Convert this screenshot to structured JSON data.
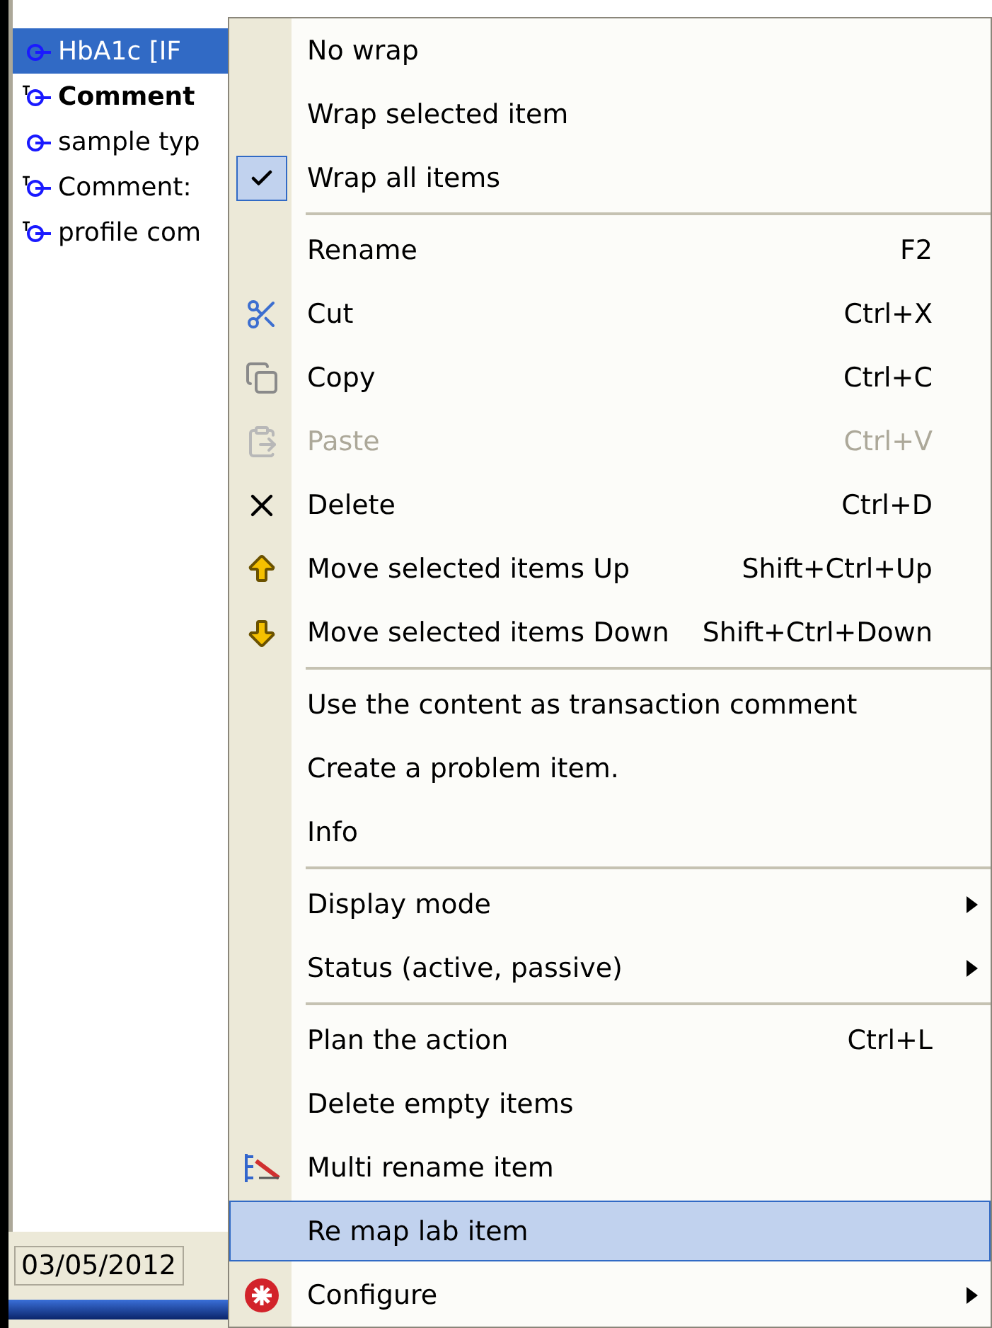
{
  "tree": {
    "rows": [
      {
        "label": "HbA1c [IF",
        "kind": "plain",
        "bold": false,
        "selected": true
      },
      {
        "label": "Comment",
        "kind": "text",
        "bold": true,
        "selected": false
      },
      {
        "label": "sample typ",
        "kind": "plain",
        "bold": false,
        "selected": false
      },
      {
        "label": "Comment:",
        "kind": "text",
        "bold": false,
        "selected": false
      },
      {
        "label": "profile com",
        "kind": "text",
        "bold": false,
        "selected": false
      }
    ]
  },
  "status_bar": {
    "date": "03/05/2012"
  },
  "context_menu": {
    "items": [
      {
        "kind": "plain",
        "label": "No wrap",
        "checked": false,
        "selected": false
      },
      {
        "kind": "plain",
        "label": "Wrap selected item",
        "checked": false,
        "selected": false
      },
      {
        "kind": "plain",
        "label": "Wrap all items",
        "checked": true,
        "selected": false
      },
      {
        "kind": "separator"
      },
      {
        "kind": "plain",
        "label": "Rename",
        "shortcut": "F2",
        "selected": false
      },
      {
        "kind": "cut",
        "label": "Cut",
        "shortcut": "Ctrl+X",
        "selected": false
      },
      {
        "kind": "copy",
        "label": "Copy",
        "shortcut": "Ctrl+C",
        "selected": false
      },
      {
        "kind": "paste",
        "label": "Paste",
        "shortcut": "Ctrl+V",
        "disabled": true,
        "selected": false
      },
      {
        "kind": "delete",
        "label": "Delete",
        "shortcut": "Ctrl+D",
        "selected": false
      },
      {
        "kind": "up",
        "label": "Move selected items Up",
        "shortcut": "Shift+Ctrl+Up",
        "selected": false
      },
      {
        "kind": "down",
        "label": "Move selected items Down",
        "shortcut": "Shift+Ctrl+Down",
        "selected": false
      },
      {
        "kind": "separator"
      },
      {
        "kind": "plain",
        "label": "Use the content as transaction comment",
        "selected": false
      },
      {
        "kind": "plain",
        "label": "Create a problem item.",
        "selected": false
      },
      {
        "kind": "plain",
        "label": "Info",
        "selected": false
      },
      {
        "kind": "separator"
      },
      {
        "kind": "plain",
        "label": "Display mode",
        "submenu": true,
        "selected": false
      },
      {
        "kind": "plain",
        "label": "Status (active, passive)",
        "submenu": true,
        "selected": false
      },
      {
        "kind": "separator"
      },
      {
        "kind": "plain",
        "label": "Plan the action",
        "shortcut": "Ctrl+L",
        "selected": false
      },
      {
        "kind": "plain",
        "label": "Delete empty items",
        "selected": false
      },
      {
        "kind": "rename",
        "label": "Multi rename item",
        "selected": false
      },
      {
        "kind": "plain",
        "label": "Re map lab item",
        "selected": true
      },
      {
        "kind": "configure",
        "label": "Configure",
        "submenu": true,
        "selected": false
      }
    ]
  }
}
